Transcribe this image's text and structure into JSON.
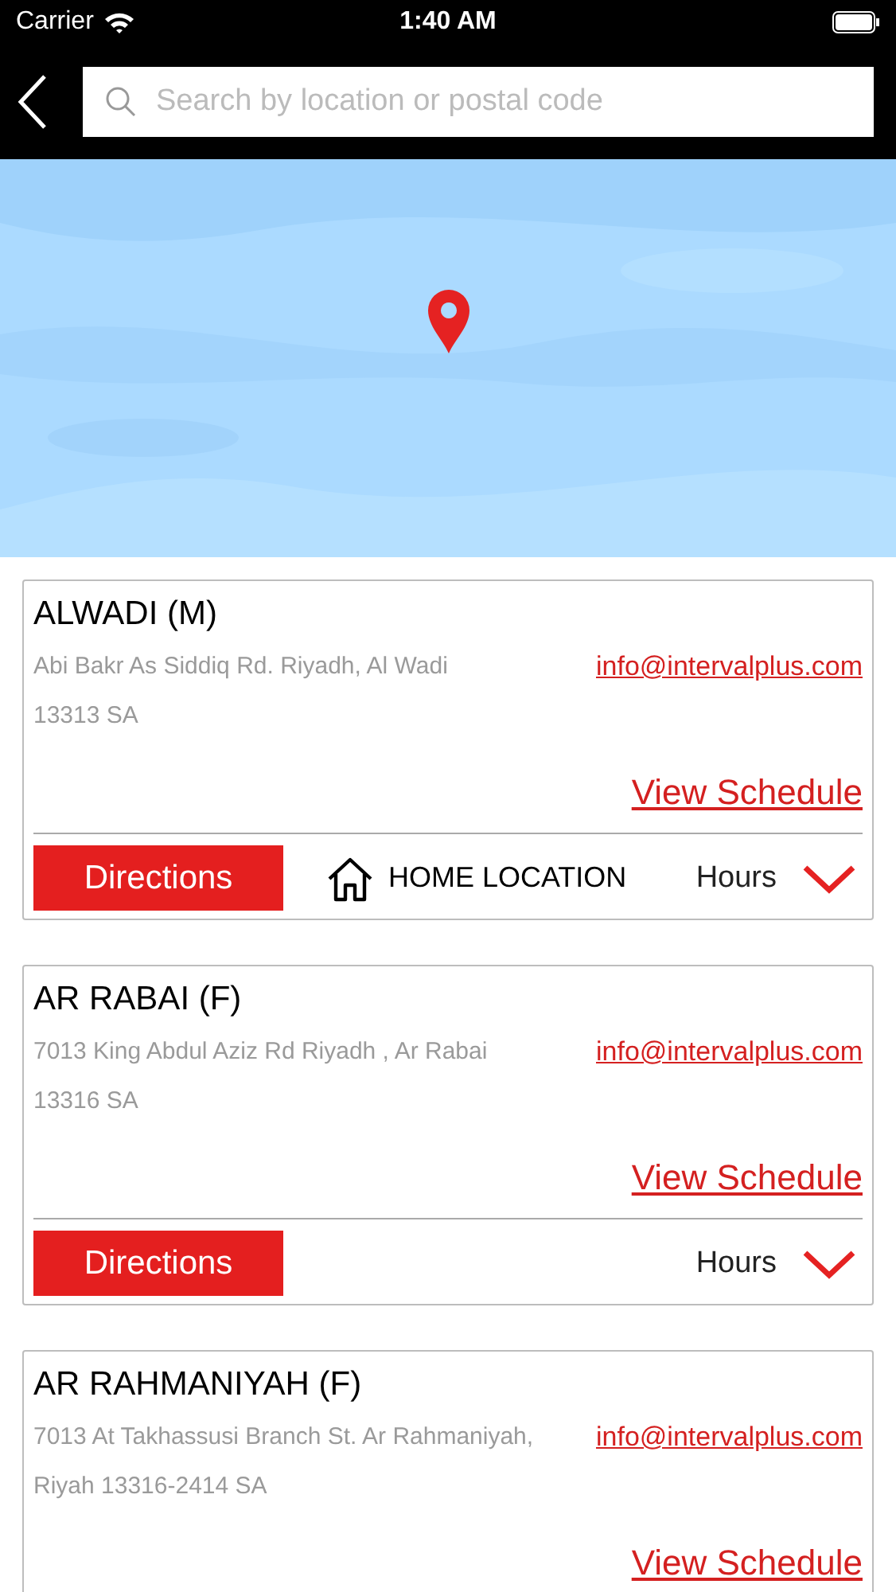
{
  "status_bar": {
    "carrier": "Carrier",
    "time": "1:40 AM"
  },
  "search": {
    "placeholder": "Search by location or postal code"
  },
  "locations": [
    {
      "name": "ALWADI (M)",
      "address_lines": [
        "Abi Bakr As Siddiq Rd. Riyadh, Al Wadi",
        "13313 SA"
      ],
      "email": "info@intervalplus.com",
      "schedule_link": "View Schedule",
      "directions": "Directions",
      "home_label": "HOME LOCATION",
      "hours": "Hours"
    },
    {
      "name": "AR RABAI (F)",
      "address_lines": [
        "7013 King Abdul Aziz Rd Riyadh , Ar Rabai",
        "13316 SA"
      ],
      "email": "info@intervalplus.com",
      "schedule_link": "View Schedule",
      "directions": "Directions",
      "hours": "Hours"
    },
    {
      "name": "AR RAHMANIYAH (F)",
      "address_lines": [
        "7013 At Takhassusi Branch St. Ar Rahmaniyah,",
        "Riyah 13316-2414 SA"
      ],
      "email": "info@intervalplus.com",
      "schedule_link": "View Schedule"
    }
  ]
}
